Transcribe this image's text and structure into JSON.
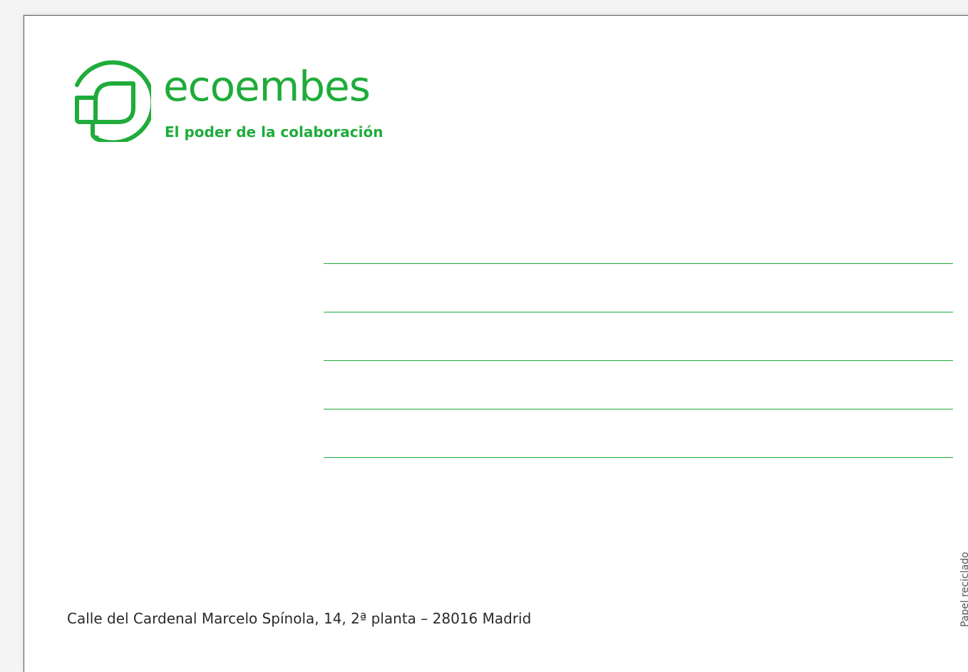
{
  "colors": {
    "brand": "#1fac3a",
    "text": "#2a2a2a"
  },
  "logo": {
    "icon": "ecoembes-leaf-logo-icon",
    "brand_name": "ecoembes",
    "tagline": "El poder de la colaboración"
  },
  "recipient": {
    "line_count": 5
  },
  "sender": {
    "address": "Calle del Cardenal Marcelo Spínola, 14, 2ª planta – 28016 Madrid"
  },
  "footer": {
    "paper_note": "Papel reciclado"
  }
}
